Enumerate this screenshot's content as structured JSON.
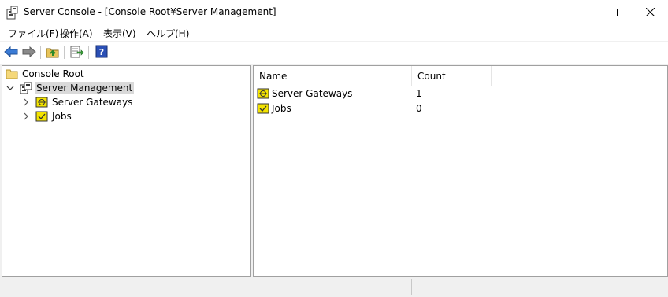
{
  "window": {
    "title": "Server Console - [Console Root¥Server Management]"
  },
  "menu": {
    "items": [
      "ファイル(F)",
      "操作(A)",
      "表示(V)",
      "ヘルプ(H)"
    ]
  },
  "toolbar": {
    "buttons": [
      "back-arrow-icon",
      "forward-arrow-icon",
      "up-folder-icon",
      "export-list-icon",
      "help-icon"
    ]
  },
  "tree": {
    "root": "Console Root",
    "management": "Server Management",
    "children": [
      "Server Gateways",
      "Jobs"
    ]
  },
  "list": {
    "columns": [
      "Name",
      "Count"
    ],
    "rows": [
      {
        "name": "Server Gateways",
        "count": "1"
      },
      {
        "name": "Jobs",
        "count": "0"
      }
    ]
  },
  "colors": {
    "folder": "#f5d87a",
    "item_icon": "#f3e300",
    "selection": "#d9d9d9",
    "back_arrow": "#3a7bd5",
    "help_icon": "#2a4fb5"
  }
}
